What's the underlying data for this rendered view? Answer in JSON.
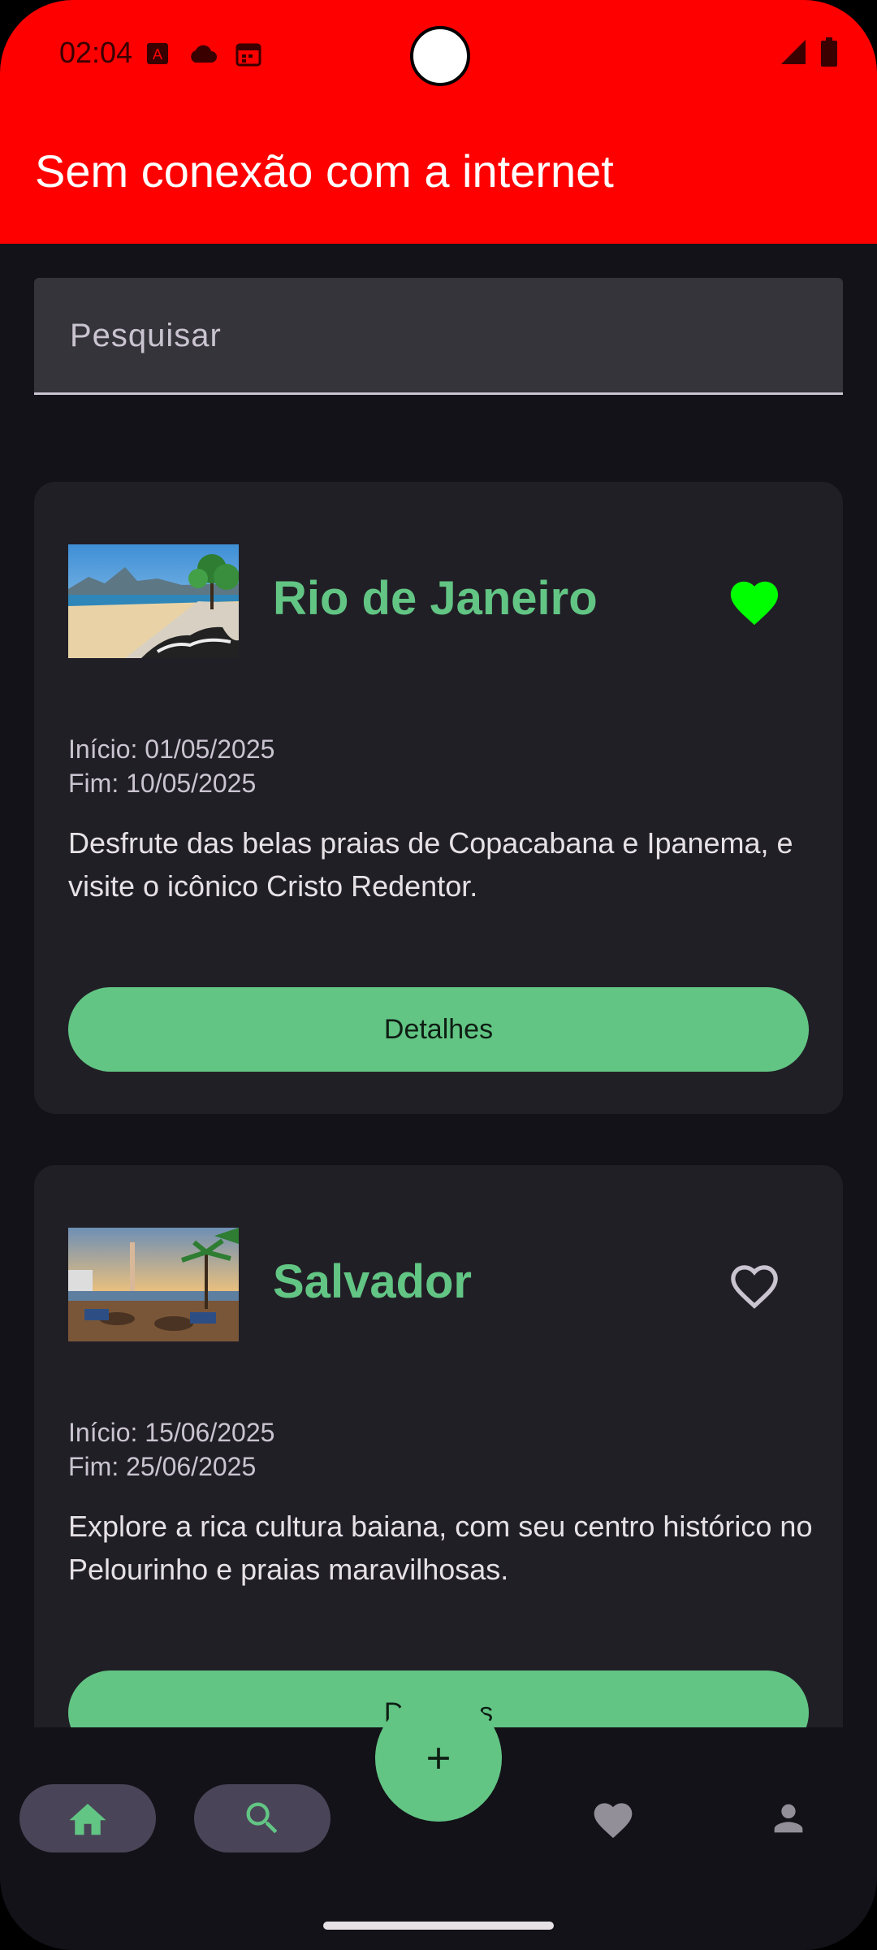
{
  "status_bar": {
    "time": "02:04",
    "left_icons": [
      "a-badge-icon",
      "cloud-icon",
      "calendar-icon"
    ],
    "right_icons": [
      "signal-icon",
      "battery-icon"
    ]
  },
  "header": {
    "title": "Sem conexão com a internet",
    "background": "#ff0000"
  },
  "search": {
    "placeholder": "Pesquisar"
  },
  "trips": [
    {
      "name": "Rio de Janeiro",
      "favorite": true,
      "start": "Início: 01/05/2025",
      "end": "Fim: 10/05/2025",
      "description": "Desfrute das belas praias de Copacabana e Ipanema, e visite o icônico Cristo Redentor.",
      "button": "Detalhes"
    },
    {
      "name": "Salvador",
      "favorite": false,
      "start": "Início: 15/06/2025",
      "end": "Fim: 25/06/2025",
      "description": "Explore a rica cultura baiana, com seu centro histórico no Pelourinho e praias maravilhosas.",
      "button": "Detalhes"
    }
  ],
  "bottom_nav": {
    "items": [
      "home-icon",
      "search-icon",
      "heart-icon",
      "person-icon"
    ],
    "fab_icon": "plus-icon"
  },
  "colors": {
    "accent": "#62c584",
    "favorite_active": "#00ff00",
    "background": "#131218",
    "card": "#211f26"
  }
}
